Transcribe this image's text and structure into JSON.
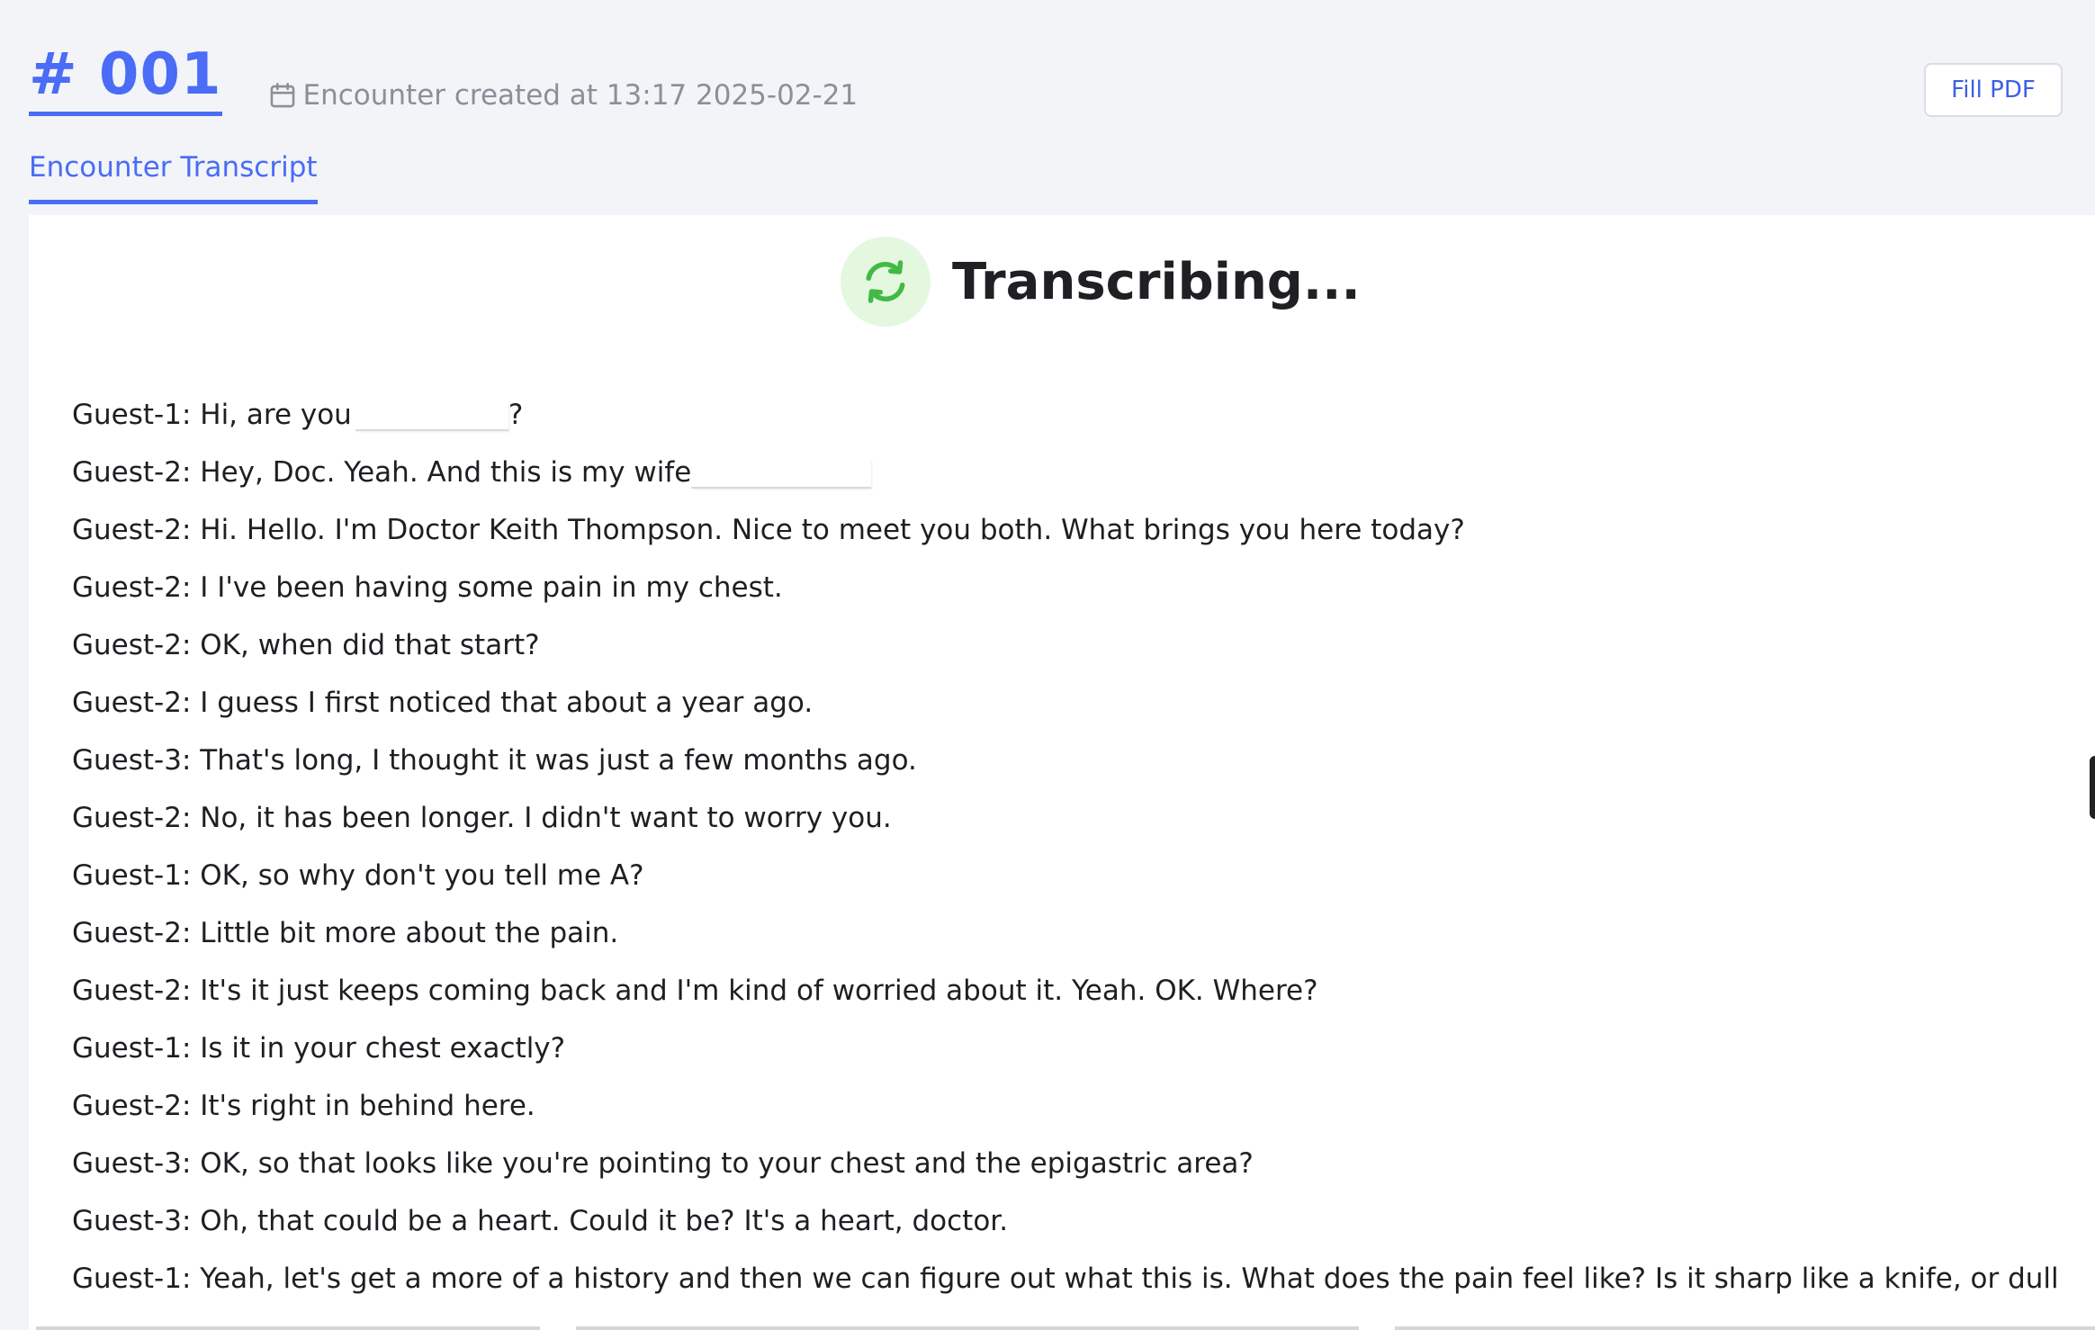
{
  "header": {
    "encounter_id": "# 001",
    "created_text": "Encounter created at 13:17 2025-02-21",
    "fill_pdf_label": "Fill PDF"
  },
  "tabs": [
    {
      "label": "Encounter Transcript",
      "active": true
    }
  ],
  "status": {
    "text": "Transcribing...",
    "icon": "refresh-icon"
  },
  "colors": {
    "accent": "#4a6cf7",
    "status_bg": "#e3f8df",
    "status_icon": "#43b945"
  },
  "transcript": [
    {
      "text": "Guest-1: Hi, are you",
      "redacted_after": true,
      "tail": "?"
    },
    {
      "text": "Guest-2: Hey, Doc. Yeah. And this is my wife",
      "redacted_after": true,
      "tail": ""
    },
    {
      "text": "Guest-2: Hi. Hello. I'm Doctor Keith Thompson. Nice to meet you both. What brings you here today?"
    },
    {
      "text": "Guest-2: I I've been having some pain in my chest."
    },
    {
      "text": "Guest-2: OK, when did that start?"
    },
    {
      "text": "Guest-2: I guess I first noticed that about a year ago."
    },
    {
      "text": "Guest-3: That's long, I thought it was just a few months ago."
    },
    {
      "text": "Guest-2: No, it has been longer. I didn't want to worry you."
    },
    {
      "text": "Guest-1: OK, so why don't you tell me A?"
    },
    {
      "text": "Guest-2: Little bit more about the pain."
    },
    {
      "text": "Guest-2: It's it just keeps coming back and I'm kind of worried about it. Yeah. OK. Where?"
    },
    {
      "text": "Guest-1: Is it in your chest exactly?"
    },
    {
      "text": "Guest-2: It's right in behind here."
    },
    {
      "text": "Guest-3: OK, so that looks like you're pointing to your chest and the epigastric area?"
    },
    {
      "text": "Guest-3: Oh, that could be a heart. Could it be? It's a heart, doctor."
    },
    {
      "text": "Guest-1: Yeah, let's get a more of a history and then we can figure out what this is. What does the pain feel like? Is it sharp like a knife, or dull or burning?"
    }
  ]
}
